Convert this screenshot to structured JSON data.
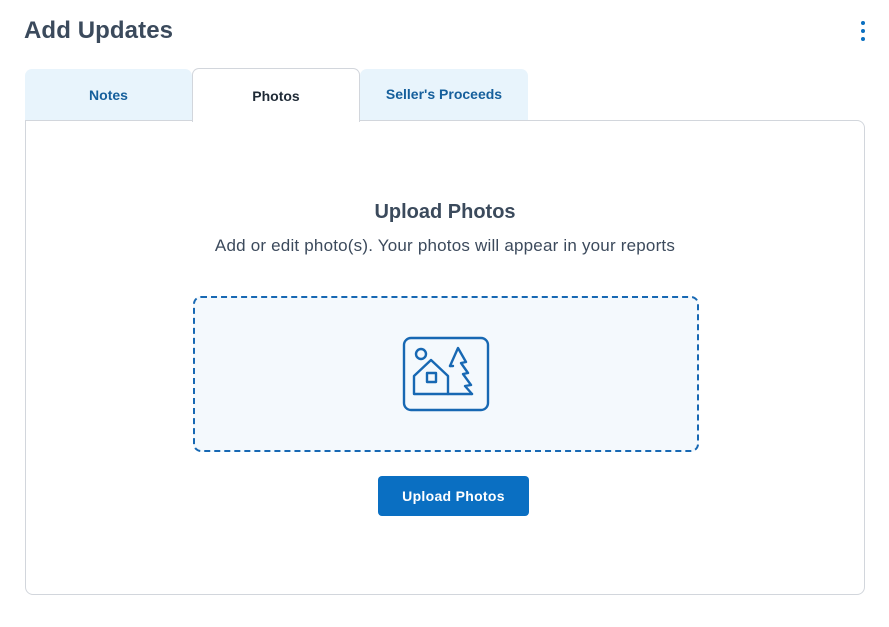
{
  "header": {
    "title": "Add Updates",
    "menu_icon": "more-vertical-icon"
  },
  "tabs": [
    {
      "label": "Notes",
      "active": false
    },
    {
      "label": "Photos",
      "active": true
    },
    {
      "label": "Seller's Proceeds",
      "active": false
    }
  ],
  "upload": {
    "title": "Upload Photos",
    "subtitle": "Add or edit photo(s). Your photos will appear in your reports",
    "dropzone_icon": "house-photo-icon",
    "button_label": "Upload Photos"
  },
  "colors": {
    "accent": "#0a6fc2",
    "tab_inactive_bg": "#e8f4fc",
    "dropzone_bg": "#f4f9fd",
    "title_text": "#3b4a5c"
  }
}
